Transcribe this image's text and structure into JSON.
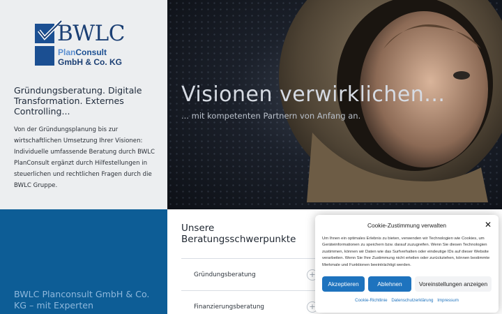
{
  "logo": {
    "name": "BWLC",
    "sub_highlight": "Plan",
    "sub_rest": "Consult",
    "sub2": "GmbH & Co. KG"
  },
  "intro": {
    "tagline": "Gründungsberatung. Digitale Transformation. Externes Controlling...",
    "text": "Von der Gründungsplanung bis zur wirtschaftlichen Umsetzung Ihrer Visionen: Individuelle umfassende Beratung durch BWLC PlanConsult ergänzt durch Hilfestellungen in steuerlichen und rechtlichen Fragen durch die BWLC Gruppe."
  },
  "hero": {
    "title": "Visionen verwirklichen...",
    "subtitle": "... mit kompetenten Partnern von Anfang an."
  },
  "company": {
    "title": "BWLC Planconsult GmbH & Co. KG – mit Experten"
  },
  "services": {
    "title": "Unsere Beratungsschwerpunkte",
    "items": [
      {
        "label": "Gründungsberatung",
        "icon": "plus-icon"
      },
      {
        "label": "Finanzierungsberatung",
        "icon": "plus-icon"
      }
    ]
  },
  "cookie": {
    "title": "Cookie-Zustimmung verwalten",
    "text": "Um Ihnen ein optimales Erlebnis zu bieten, verwenden wir Technologien wie Cookies, um Geräteinformationen zu speichern bzw. darauf zuzugreifen. Wenn Sie diesen Technologien zustimmen, können wir Daten wie das Surfverhalten oder eindeutige IDs auf dieser Website verarbeiten. Wenn Sie Ihre Zustimmung nicht erteilen oder zurückziehen, können bestimmte Merkmale und Funktionen beeinträchtigt werden.",
    "accept": "Akzeptieren",
    "deny": "Ablehnen",
    "preferences": "Voreinstellungen anzeigen",
    "links": [
      "Cookie-Richtlinie",
      "Datenschutzerklärung",
      "Impressum"
    ],
    "close_icon": "close-icon"
  },
  "colors": {
    "brand_blue": "#1b4f92",
    "panel_blue": "#0d5d96",
    "button_blue": "#1e73be"
  }
}
